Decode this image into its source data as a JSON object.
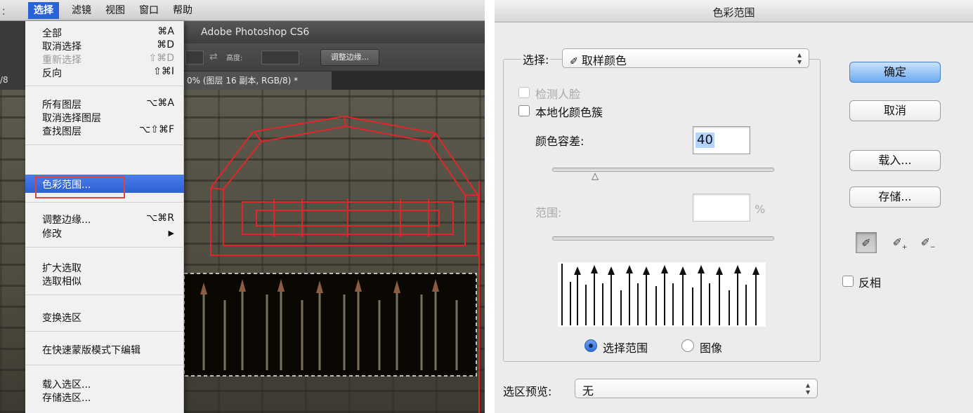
{
  "menubar": {
    "edge": "：",
    "items": [
      "选择",
      "滤镜",
      "视图",
      "窗口",
      "帮助"
    ]
  },
  "photoshop": {
    "title": "Adobe Photoshop CS6",
    "options": {
      "height_label": "高度:",
      "refine_button": "调整边缘..."
    },
    "doc_tab": "0% (图层 16 副本, RGB/8) *",
    "doc_tab_edge": "/8"
  },
  "select_menu": {
    "items": [
      {
        "label": "全部",
        "shortcut": "⌘A"
      },
      {
        "label": "取消选择",
        "shortcut": "⌘D"
      },
      {
        "label": "重新选择",
        "shortcut": "⇧⌘D"
      },
      {
        "label": "反向",
        "shortcut": "⇧⌘I"
      },
      {
        "label": "所有图层",
        "shortcut": "⌥⌘A"
      },
      {
        "label": "取消选择图层",
        "shortcut": ""
      },
      {
        "label": "查找图层",
        "shortcut": "⌥⇧⌘F"
      },
      {
        "label": "色彩范围...",
        "shortcut": ""
      },
      {
        "label": "调整边缘...",
        "shortcut": "⌥⌘R"
      },
      {
        "label": "修改",
        "shortcut": "▶"
      },
      {
        "label": "扩大选取",
        "shortcut": ""
      },
      {
        "label": "选取相似",
        "shortcut": ""
      },
      {
        "label": "变换选区",
        "shortcut": ""
      },
      {
        "label": "在快速蒙版模式下编辑",
        "shortcut": ""
      },
      {
        "label": "载入选区...",
        "shortcut": ""
      },
      {
        "label": "存储选区...",
        "shortcut": ""
      }
    ]
  },
  "dialog": {
    "title": "色彩范围",
    "select_label": "选择:",
    "select_value": "取样颜色",
    "select_icon": "eyedropper-icon",
    "detect_faces": "检测人脸",
    "localized_clusters": "本地化颜色簇",
    "fuzziness_label": "颜色容差:",
    "fuzziness_value": "40",
    "range_label": "范围:",
    "range_unit": "%",
    "radio_selection": "选择范围",
    "radio_image": "图像",
    "preview_label": "选区预览:",
    "preview_value": "无",
    "buttons": {
      "ok": "确定",
      "cancel": "取消",
      "load": "载入...",
      "save": "存储..."
    },
    "invert": "反相",
    "colors": {
      "accent": "#2d5fd6",
      "highlight_outline": "#e0433b",
      "default_button": "#6caaf1"
    }
  }
}
